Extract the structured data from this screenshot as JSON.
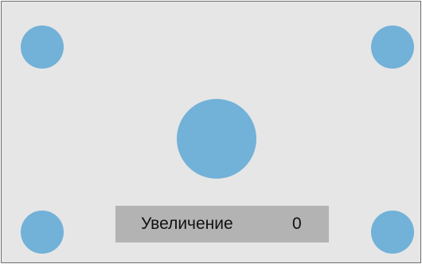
{
  "colors": {
    "background": "#e6e6e6",
    "border": "#6f6f6f",
    "dot": "#72b1d8",
    "osd_bar": "#b3b3b3",
    "text": "#111111"
  },
  "dots": [
    {
      "name": "top-left"
    },
    {
      "name": "top-right"
    },
    {
      "name": "center"
    },
    {
      "name": "bottom-left"
    },
    {
      "name": "bottom-right"
    }
  ],
  "osd": {
    "label": "Увеличение",
    "value": "0"
  }
}
